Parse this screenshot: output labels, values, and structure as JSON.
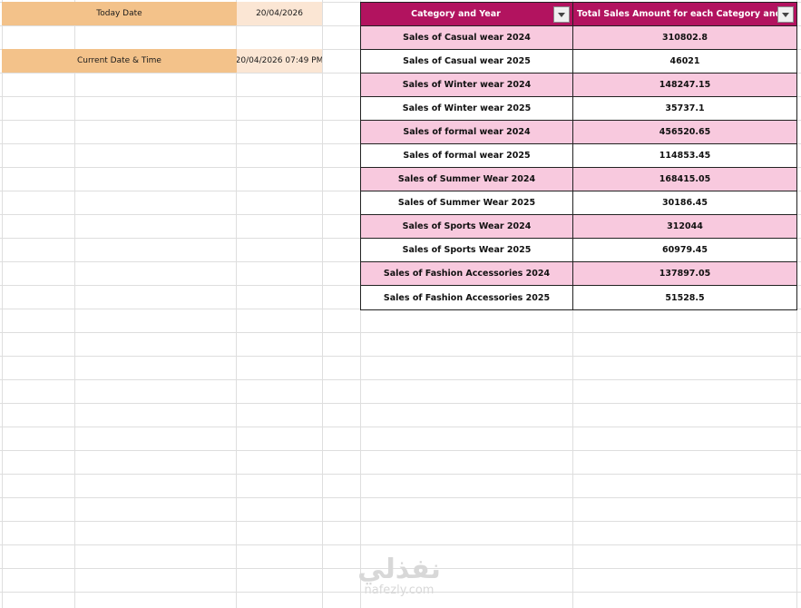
{
  "left": {
    "today_label": "Today Date",
    "today_value": "20/04/2026",
    "now_label": "Current Date & Time",
    "now_value": "20/04/2026 07:49 PM"
  },
  "table": {
    "headers": [
      "Category and Year",
      "Total Sales Amount for each Category and Y"
    ],
    "rows": [
      {
        "category": "Sales of Casual wear 2024",
        "amount": "310802.8"
      },
      {
        "category": "Sales of Casual wear 2025",
        "amount": "46021"
      },
      {
        "category": "Sales of Winter wear 2024",
        "amount": "148247.15"
      },
      {
        "category": "Sales of Winter wear 2025",
        "amount": "35737.1"
      },
      {
        "category": "Sales of formal wear 2024",
        "amount": "456520.65"
      },
      {
        "category": "Sales of formal wear 2025",
        "amount": "114853.45"
      },
      {
        "category": "Sales of Summer Wear 2024",
        "amount": "168415.05"
      },
      {
        "category": "Sales of Summer Wear 2025",
        "amount": "30186.45"
      },
      {
        "category": "Sales of Sports Wear 2024",
        "amount": "312044"
      },
      {
        "category": "Sales of Sports Wear 2025",
        "amount": "60979.45"
      },
      {
        "category": "Sales of Fashion Accessories 2024",
        "amount": "137897.05"
      },
      {
        "category": "Sales of Fashion Accessories 2025",
        "amount": "51528.5"
      }
    ]
  },
  "watermark": {
    "arabic": "نفذلي",
    "latin": "nafezly.com"
  },
  "icons": {
    "filter_dropdown": "chevron-down-icon"
  },
  "colors": {
    "header": "#b2135f",
    "pink_row": "#f8c9de",
    "orange_label": "#f3c28a",
    "cream_value": "#fbe6d4"
  }
}
